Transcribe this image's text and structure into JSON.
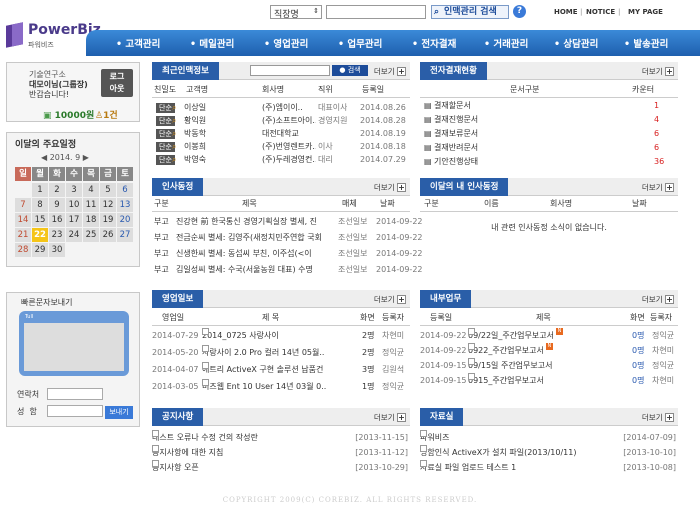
{
  "brand": {
    "logo_text": "PowerBiz",
    "logo_sub": "파워비즈"
  },
  "top": {
    "select_value": "직장명",
    "search_btn": "인맥관리 검색",
    "help": "?",
    "links": [
      "HOME",
      "NOTICE",
      "MY PAGE"
    ]
  },
  "nav": [
    "고객관리",
    "메일관리",
    "영업관리",
    "업무관리",
    "전자결재",
    "거래관리",
    "상담관리",
    "발송관리"
  ],
  "login": {
    "line1": "기술연구소",
    "line2": "대모이님(그룹장)",
    "line3": "반갑습니다!",
    "logout": "로그\n아웃",
    "points": "10000원",
    "count": "1건"
  },
  "calendar": {
    "title": "이달의 주요일정",
    "month": "◀ 2014. 9 ▶",
    "days": [
      "일",
      "월",
      "화",
      "수",
      "목",
      "금",
      "토"
    ],
    "dates": [
      "",
      "1",
      "2",
      "3",
      "4",
      "5",
      "6",
      "7",
      "8",
      "9",
      "10",
      "11",
      "12",
      "13",
      "14",
      "15",
      "16",
      "17",
      "18",
      "19",
      "20",
      "21",
      "22",
      "23",
      "24",
      "25",
      "26",
      "27",
      "28",
      "29",
      "30",
      "",
      "",
      "",
      ""
    ]
  },
  "sms": {
    "title": "빠른문자보내기",
    "ant": "Tull",
    "contact_label": "연락처",
    "name_label": "성  함",
    "send": "보내기"
  },
  "contacts": {
    "title": "최근인맥정보",
    "search": "검색",
    "more": "더보기",
    "headers": [
      "친밀도",
      "고객명",
      "회사명",
      "직위",
      "등록일"
    ],
    "rows": [
      [
        "단순",
        "이상일",
        "(주)엠이이..",
        "대표이사",
        "2014.08.26"
      ],
      [
        "단순",
        "황익원",
        "(주)소프트아이..",
        "경영지원",
        "2014.08.28"
      ],
      [
        "단순",
        "박동학",
        "대전대학교",
        "",
        "2014.08.19"
      ],
      [
        "단순",
        "이봉희",
        "(주)번영렌트카..",
        "이사",
        "2014.08.18"
      ],
      [
        "단순",
        "박영숙",
        "(주)두레경영컨..",
        "대리",
        "2014.07.29"
      ]
    ]
  },
  "approval": {
    "title": "전자결재현황",
    "more": "더보기",
    "headers": [
      "문서구분",
      "카운터"
    ],
    "rows": [
      [
        "결재할문서",
        "1"
      ],
      [
        "결재진행문서",
        "4"
      ],
      [
        "결재보류문서",
        "6"
      ],
      [
        "결재반려문서",
        "6"
      ],
      [
        "기안진행상태",
        "36"
      ]
    ]
  },
  "hr": {
    "title": "인사동정",
    "more": "더보기",
    "headers": [
      "구분",
      "제목",
      "매체",
      "날짜"
    ],
    "rows": [
      [
        "부고",
        "진강현 前 한국통신 경영기획실장 별세, 진",
        "조선일보",
        "2014-09-22"
      ],
      [
        "부고",
        "전금순씨 별세: 김영주(새정치민주연합 국회",
        "조선일보",
        "2014-09-22"
      ],
      [
        "부고",
        "신생한씨 별세: 동섭씨 부친, 이주섭(<이",
        "조선일보",
        "2014-09-22"
      ],
      [
        "부고",
        "김일성씨 별세: 수국(서울농원 대표) 수명",
        "조선일보",
        "2014-09-22"
      ]
    ]
  },
  "myhr": {
    "title": "이달의 내 인사동정",
    "more": "더보기",
    "headers": [
      "구분",
      "이름",
      "회사명",
      "날짜"
    ],
    "empty": "내 관련 인사동정 소식이 없습니다."
  },
  "sales": {
    "title": "영업일보",
    "more": "더보기",
    "headers": [
      "영업일",
      "제 목",
      "화면",
      "등록자"
    ],
    "rows": [
      [
        "2014-07-29",
        "2014_0725 사랑사이",
        "2명",
        "차현미"
      ],
      [
        "2014-05-20",
        "사랑사이 2.0 Pro 컬러 14년 05월..",
        "2명",
        "정익균"
      ],
      [
        "2014-04-07",
        "에트리 ActiveX 구현 솔루션 납품건",
        "3명",
        "김원석"
      ],
      [
        "2014-03-05",
        "비즈웹 Ent 10 User 14년 03월 0..",
        "1명",
        "정익균"
      ]
    ]
  },
  "work": {
    "title": "내부업무",
    "more": "더보기",
    "headers": [
      "등록일",
      "제목",
      "화면",
      "등록자"
    ],
    "rows": [
      [
        "2014-09-22",
        "09/22일_주간업무보고서",
        "0명",
        "정익균"
      ],
      [
        "2014-09-22",
        "0922_주간업무보고서",
        "0명",
        "차현미"
      ],
      [
        "2014-09-15",
        "09/15일 주간업무보고서",
        "0명",
        "정익균"
      ],
      [
        "2014-09-15",
        "0915_주간업무보고서",
        "0명",
        "차현미"
      ]
    ]
  },
  "notice": {
    "title": "공지사항",
    "more": "더보기",
    "rows": [
      [
        "테스트 오류나 수정 건의 작성란",
        "[2013-11-15]"
      ],
      [
        "공지사항에 대한 지침",
        "[2013-11-12]"
      ],
      [
        "공지사항 오픈",
        "[2013-10-29]"
      ]
    ]
  },
  "files": {
    "title": "자료실",
    "more": "더보기",
    "rows": [
      [
        "파워비즈",
        "[2014-07-09]"
      ],
      [
        "명함인식 ActiveX가 설치 파일(2013/10/11)",
        "[2013-10-10]"
      ],
      [
        "자료실 파일 업로드 테스트 1",
        "[2013-10-08]"
      ]
    ]
  },
  "copyright": "COPYRIGHT 2009(C) COREBIZ. ALL RIGHTS RESERVED."
}
